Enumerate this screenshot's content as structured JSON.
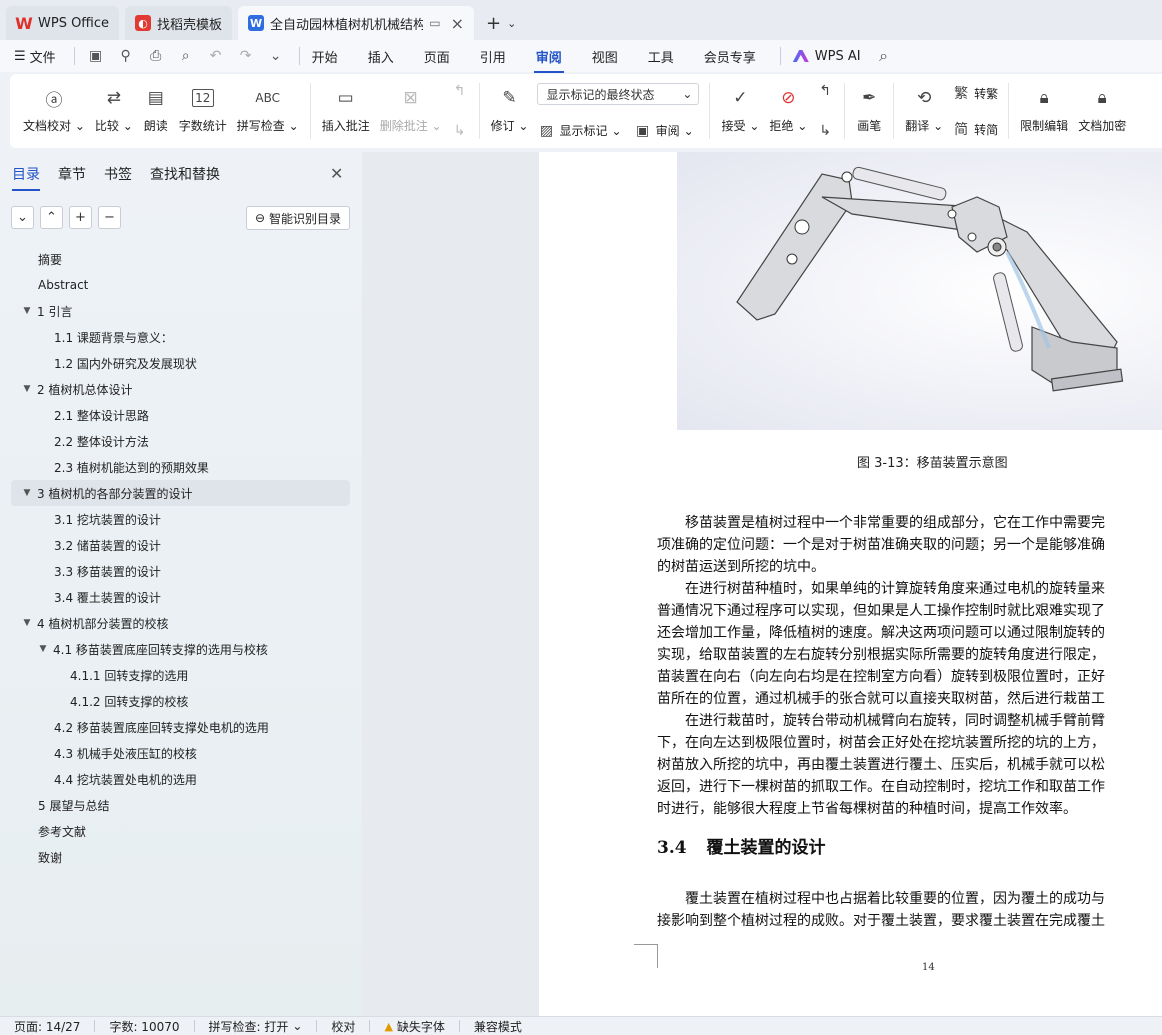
{
  "tabs": [
    {
      "label": "WPS Office",
      "icon": "wps-logo-icon"
    },
    {
      "label": "找稻壳模板",
      "icon": "docer-icon"
    },
    {
      "label": "全自动园林植树机机械结构设",
      "icon": "word-doc-icon"
    }
  ],
  "menu": {
    "file_label": "文件",
    "items": [
      "开始",
      "插入",
      "页面",
      "引用",
      "审阅",
      "视图",
      "工具",
      "会员专享"
    ],
    "active": "审阅",
    "ai_label": "WPS AI"
  },
  "ribbon": {
    "doc_proof": "文档校对",
    "compare": "比较",
    "read_aloud": "朗读",
    "word_count": "字数统计",
    "spell_check": "拼写检查",
    "insert_comment": "插入批注",
    "delete_comment": "删除批注",
    "track_changes": "修订",
    "markup_state": "显示标记的最终状态",
    "show_markup": "显示标记",
    "review": "审阅",
    "accept": "接受",
    "reject": "拒绝",
    "pen": "画笔",
    "translate": "翻译",
    "to_traditional": "转繁",
    "to_simplified": "转简",
    "restrict_edit": "限制编辑",
    "encrypt": "文档加密",
    "word_count_icon_text": "12",
    "spell_icon_text": "ABC"
  },
  "nav": {
    "tabs": [
      "目录",
      "章节",
      "书签",
      "查找和替换"
    ],
    "active_tab": "目录",
    "smart_toc": "智能识别目录",
    "toc": [
      {
        "text": "摘要",
        "level": 1,
        "toggle": false
      },
      {
        "text": "Abstract",
        "level": 1,
        "toggle": false
      },
      {
        "text": "1  引言",
        "level": 1,
        "toggle": true
      },
      {
        "text": "1.1  课题背景与意义：",
        "level": 2,
        "toggle": false
      },
      {
        "text": "1.2  国内外研究及发展现状",
        "level": 2,
        "toggle": false
      },
      {
        "text": "2  植树机总体设计",
        "level": 1,
        "toggle": true
      },
      {
        "text": "2.1    整体设计思路",
        "level": 2,
        "toggle": false
      },
      {
        "text": "2.2  整体设计方法",
        "level": 2,
        "toggle": false
      },
      {
        "text": "2.3 植树机能达到的预期效果",
        "level": 2,
        "toggle": false
      },
      {
        "text": "3    植树机的各部分装置的设计",
        "level": 1,
        "toggle": true,
        "selected": true
      },
      {
        "text": "3.1  挖坑装置的设计",
        "level": 2,
        "toggle": false
      },
      {
        "text": "3.2  储苗装置的设计",
        "level": 2,
        "toggle": false
      },
      {
        "text": "3.3    移苗装置的设计",
        "level": 2,
        "toggle": false
      },
      {
        "text": "3.4    覆土装置的设计",
        "level": 2,
        "toggle": false
      },
      {
        "text": "4    植树机部分装置的校核",
        "level": 1,
        "toggle": true
      },
      {
        "text": "4.1  移苗装置底座回转支撑的选用与校核",
        "level": 2,
        "toggle": true
      },
      {
        "text": "4.1.1  回转支撑的选用",
        "level": 3,
        "toggle": false
      },
      {
        "text": "4.1.2 回转支撑的校核",
        "level": 3,
        "toggle": false
      },
      {
        "text": "4.2 移苗装置底座回转支撑处电机的选用",
        "level": 2,
        "toggle": false
      },
      {
        "text": "4.3  机械手处液压缸的校核",
        "level": 2,
        "toggle": false
      },
      {
        "text": "4.4 挖坑装置处电机的选用",
        "level": 2,
        "toggle": false
      },
      {
        "text": "5    展望与总结",
        "level": 1,
        "toggle": false
      },
      {
        "text": "参考文献",
        "level": 1,
        "toggle": false
      },
      {
        "text": "致谢",
        "level": 1,
        "toggle": false
      }
    ]
  },
  "document": {
    "caption": "图 3-13：移苗装置示意图",
    "para1": [
      "移苗装置是植树过程中一个非常重要的组成部分，它在工作中需要完",
      "项准确的定位问题：一个是对于树苗准确夹取的问题；另一个是能够准确",
      "的树苗运送到所挖的坑中。"
    ],
    "para2": [
      "在进行树苗种植时，如果单纯的计算旋转角度来通过电机的旋转量来",
      "普通情况下通过程序可以实现，但如果是人工操作控制时就比艰难实现了",
      "还会增加工作量，降低植树的速度。解决这两项问题可以通过限制旋转的",
      "实现，给取苗装置的左右旋转分别根据实际所需要的旋转角度进行限定，",
      "苗装置在向右（向左向右均是在控制室方向看）旋转到极限位置时，正好",
      "苗所在的位置，通过机械手的张合就可以直接夹取树苗，然后进行栽苗工"
    ],
    "para3": [
      "在进行栽苗时，旋转台带动机械臂向右旋转，同时调整机械手臂前臂",
      "下，在向左达到极限位置时，树苗会正好处在挖坑装置所挖的坑的上方，",
      "树苗放入所挖的坑中，再由覆土装置进行覆土、压实后，机械手就可以松",
      "返回，进行下一棵树苗的抓取工作。在自动控制时，挖坑工作和取苗工作",
      "时进行，能够很大程度上节省每棵树苗的种植时间，提高工作效率。"
    ],
    "heading_num": "3.4",
    "heading_text": "覆土装置的设计",
    "para4": [
      "覆土装置在植树过程中也占据着比较重要的位置，因为覆土的成功与",
      "接影响到整个植树过程的成败。对于覆土装置，要求覆土装置在完成覆土"
    ],
    "page_number": "14"
  },
  "status": {
    "page": "页面: 14/27",
    "words": "字数: 10070",
    "spell": "拼写检查: 打开",
    "proof": "校对",
    "missing_font": "缺失字体",
    "compat": "兼容模式"
  }
}
